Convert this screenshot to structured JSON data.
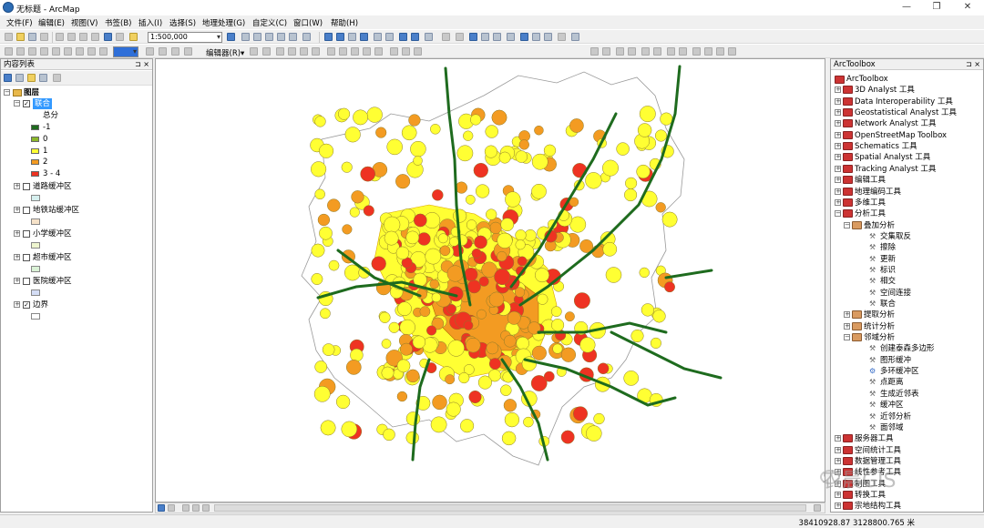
{
  "title": "无标题 - ArcMap",
  "window_controls": {
    "min": "—",
    "max": "❐",
    "close": "✕"
  },
  "menu": [
    "文件(F)",
    "编辑(E)",
    "视图(V)",
    "书签(B)",
    "插入(I)",
    "选择(S)",
    "地理处理(G)",
    "自定义(C)",
    "窗口(W)",
    "帮助(H)"
  ],
  "toolbar": {
    "scale": "1:500,000",
    "editor": "编辑器(R)▾"
  },
  "toc": {
    "title": "内容列表",
    "pin": "⊐ ×",
    "root": "图层",
    "layers": [
      {
        "name": "联合",
        "checked": true,
        "expanded": true,
        "field": "总分",
        "classes": [
          {
            "label": "-1",
            "color": "#1e6b1e"
          },
          {
            "label": "0",
            "color": "#8bb82b"
          },
          {
            "label": "1",
            "color": "#ffff33"
          },
          {
            "label": "2",
            "color": "#f39b22"
          },
          {
            "label": "3 - 4",
            "color": "#ee3322"
          }
        ]
      },
      {
        "name": "道路缓冲区",
        "checked": false,
        "swatch": "#d6f0ef"
      },
      {
        "name": "地铁站缓冲区",
        "checked": false,
        "swatch": "#f6e2c8"
      },
      {
        "name": "小学缓冲区",
        "checked": false,
        "swatch": "#eef5cf"
      },
      {
        "name": "超市缓冲区",
        "checked": false,
        "swatch": "#daf2d6"
      },
      {
        "name": "医院缓冲区",
        "checked": false,
        "swatch": "#d4ddf5"
      },
      {
        "name": "边界",
        "checked": true,
        "swatch": "#ffffff"
      }
    ]
  },
  "toolbox": {
    "title": "ArcToolbox",
    "pin": "⊐ ×",
    "root": "ArcToolbox",
    "items": [
      {
        "label": "3D Analyst 工具",
        "level": 0,
        "exp": "+"
      },
      {
        "label": "Data Interoperability 工具",
        "level": 0,
        "exp": "+"
      },
      {
        "label": "Geostatistical Analyst 工具",
        "level": 0,
        "exp": "+"
      },
      {
        "label": "Network Analyst 工具",
        "level": 0,
        "exp": "+"
      },
      {
        "label": "OpenStreetMap Toolbox",
        "level": 0,
        "exp": "+"
      },
      {
        "label": "Schematics 工具",
        "level": 0,
        "exp": "+"
      },
      {
        "label": "Spatial Analyst 工具",
        "level": 0,
        "exp": "+"
      },
      {
        "label": "Tracking Analyst 工具",
        "level": 0,
        "exp": "+"
      },
      {
        "label": "编辑工具",
        "level": 0,
        "exp": "+"
      },
      {
        "label": "地理编码工具",
        "level": 0,
        "exp": "+"
      },
      {
        "label": "多维工具",
        "level": 0,
        "exp": "+"
      },
      {
        "label": "分析工具",
        "level": 0,
        "exp": "−"
      },
      {
        "label": "叠加分析",
        "level": 1,
        "exp": "−"
      },
      {
        "label": "交集取反",
        "level": 2,
        "tool": true
      },
      {
        "label": "擦除",
        "level": 2,
        "tool": true
      },
      {
        "label": "更新",
        "level": 2,
        "tool": true
      },
      {
        "label": "标识",
        "level": 2,
        "tool": true
      },
      {
        "label": "相交",
        "level": 2,
        "tool": true
      },
      {
        "label": "空间连接",
        "level": 2,
        "tool": true
      },
      {
        "label": "联合",
        "level": 2,
        "tool": true
      },
      {
        "label": "提取分析",
        "level": 1,
        "exp": "+"
      },
      {
        "label": "统计分析",
        "level": 1,
        "exp": "+"
      },
      {
        "label": "邻域分析",
        "level": 1,
        "exp": "−"
      },
      {
        "label": "创建泰森多边形",
        "level": 2,
        "tool": true
      },
      {
        "label": "图形缓冲",
        "level": 2,
        "tool": true
      },
      {
        "label": "多环缓冲区",
        "level": 2,
        "tool": true,
        "script": true
      },
      {
        "label": "点距离",
        "level": 2,
        "tool": true
      },
      {
        "label": "生成近邻表",
        "level": 2,
        "tool": true
      },
      {
        "label": "缓冲区",
        "level": 2,
        "tool": true
      },
      {
        "label": "近邻分析",
        "level": 2,
        "tool": true
      },
      {
        "label": "面邻域",
        "level": 2,
        "tool": true
      },
      {
        "label": "服务器工具",
        "level": 0,
        "exp": "+"
      },
      {
        "label": "空间统计工具",
        "level": 0,
        "exp": "+"
      },
      {
        "label": "数据管理工具",
        "level": 0,
        "exp": "+"
      },
      {
        "label": "线性参考工具",
        "level": 0,
        "exp": "+"
      },
      {
        "label": "制图工具",
        "level": 0,
        "exp": "+"
      },
      {
        "label": "转换工具",
        "level": 0,
        "exp": "+"
      },
      {
        "label": "宗地结构工具",
        "level": 0,
        "exp": "+"
      }
    ]
  },
  "status": {
    "coords": "38410928.87  3128800.765 米"
  },
  "watermark": "农晨GIS"
}
